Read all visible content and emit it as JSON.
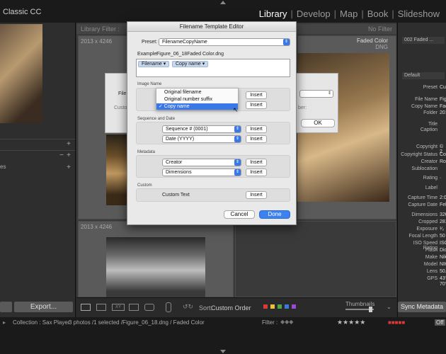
{
  "app": {
    "title": "Classic CC"
  },
  "modules": [
    {
      "label": "Library",
      "active": true
    },
    {
      "label": "Develop",
      "active": false
    },
    {
      "label": "Map",
      "active": false
    },
    {
      "label": "Book",
      "active": false
    },
    {
      "label": "Slideshow",
      "active": false
    }
  ],
  "left_panel": {
    "export_label": "Export...",
    "row_plus": "+",
    "row_minus": "−",
    "row3_text": "es"
  },
  "filter_bar": {
    "title": "Library Filter :",
    "no_filter": "No Filter"
  },
  "grid": {
    "cell1_dims": "2013 x 4246",
    "cell4_dims": "2013 x 4246",
    "faded_title": "Faded Color",
    "faded_sub": "DNG"
  },
  "toolbar": {
    "sort_label": "Sort:",
    "sort_value": "Custom Order",
    "thumbnails_label": "Thumbnails",
    "color_labels": [
      "#d83a3a",
      "#e6c43a",
      "#4aa84a",
      "#3a7ad8",
      "#9a4ad8"
    ]
  },
  "right_panel": {
    "preset_dropdown": "002 Faded ...",
    "default_label": "Default",
    "rows": [
      {
        "label": "Preset",
        "value": "Cus"
      },
      {
        "label": "File Name",
        "value": "Figu"
      },
      {
        "label": "Copy Name",
        "value": "Fade"
      },
      {
        "label": "Folder",
        "value": "201"
      },
      {
        "label": "Title",
        "value": ""
      },
      {
        "label": "Caption",
        "value": ""
      },
      {
        "label": "Copyright",
        "value": "© 2"
      },
      {
        "label": "Copyright Status",
        "value": "Cop"
      },
      {
        "label": "Creator",
        "value": "Rob"
      },
      {
        "label": "Sublocation",
        "value": ""
      },
      {
        "label": "Rating",
        "value": "·"
      },
      {
        "label": "Label",
        "value": ""
      },
      {
        "label": "Capture Time",
        "value": "2:04"
      },
      {
        "label": "Capture Date",
        "value": "Feb"
      },
      {
        "label": "Dimensions",
        "value": "326"
      },
      {
        "label": "Cropped",
        "value": "281"
      },
      {
        "label": "Exposure",
        "value": "¹⁄₂"
      },
      {
        "label": "Focal Length",
        "value": "50"
      },
      {
        "label": "ISO Speed Rating",
        "value": "ISO"
      },
      {
        "label": "Flash",
        "value": "Did"
      },
      {
        "label": "Make",
        "value": "Nik"
      },
      {
        "label": "Model",
        "value": "NIK"
      },
      {
        "label": "Lens",
        "value": "50.0"
      },
      {
        "label": "GPS",
        "value": "43°"
      },
      {
        "label": "",
        "value": "70°"
      }
    ],
    "sync_label": "Sync Metadata"
  },
  "status_bar": {
    "collection": "Collection : Sax Player",
    "count": "3 photos /1 selected /Figure_06_18.dng / Faded Color",
    "filter_label": "Filter :",
    "off_label": "Off"
  },
  "bg_dialog": {
    "label1": "File",
    "label2": "Custo",
    "label3": "ber:",
    "ok_label": "OK"
  },
  "dialog": {
    "title": "Filename Template Editor",
    "preset_label": "Preset:",
    "preset_value": "FilenameCopyName",
    "example_label": "Example:",
    "example_value": "Figure_06_18Faded Color.dng",
    "tokens": [
      "Filename",
      "Copy name"
    ],
    "image_name": {
      "title": "Image Name",
      "insert1": "Insert",
      "insert2": "Insert",
      "popup_items": [
        {
          "label": "Original filename",
          "checked": false
        },
        {
          "label": "Original number suffix",
          "checked": false
        },
        {
          "label": "Copy name",
          "checked": true
        }
      ]
    },
    "sequence": {
      "title": "Sequence and Date",
      "select1": "Sequence # (0001)",
      "select2": "Date (YYYY)",
      "insert1": "Insert",
      "insert2": "Insert"
    },
    "metadata": {
      "title": "Metadata",
      "select1": "Creator",
      "select2": "Dimensions",
      "insert1": "Insert",
      "insert2": "Insert"
    },
    "custom": {
      "title": "Custom",
      "label": "Custom Text",
      "insert": "Insert"
    },
    "cancel_label": "Cancel",
    "done_label": "Done"
  }
}
